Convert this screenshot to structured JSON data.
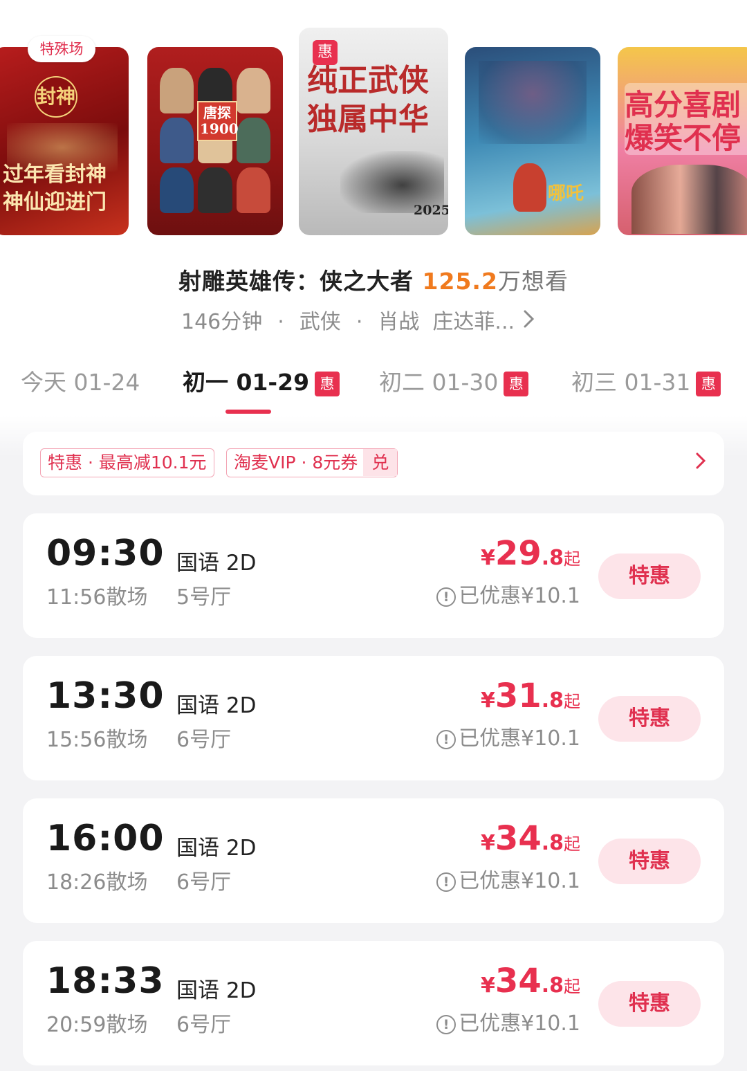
{
  "posters": {
    "special_tag": "特殊场",
    "hui_tag": "惠",
    "p1_line1": "过年看封神",
    "p1_line2": "神仙迎进门",
    "p1_logo": "封神",
    "p2_logo": "唐探1900",
    "p3_line1": "纯正武侠",
    "p3_line2": "独属中华",
    "p3_year": "2025",
    "p4_logo": "哪吒",
    "p5_line1": "高分喜剧",
    "p5_line2": "爆笑不停"
  },
  "movie": {
    "title": "射雕英雄传：侠之大者",
    "want_count": "125.2",
    "want_text": "万想看",
    "duration": "146分钟",
    "genre": "武侠",
    "cast": "肖战  庄达菲...",
    "separator": "·"
  },
  "dates": [
    {
      "label": "今天 01-24",
      "badge": ""
    },
    {
      "label": "初一 01-29",
      "badge": "惠"
    },
    {
      "label": "初二 01-30",
      "badge": "惠"
    },
    {
      "label": "初三 01-31",
      "badge": "惠"
    }
  ],
  "promo": {
    "chip1": "特惠 · 最高减10.1元",
    "chip2": "淘麦VIP · 8元券",
    "chip2_action": "兑",
    "arrow": "›"
  },
  "showtimes": [
    {
      "time": "09:30",
      "end": "11:56散场",
      "lang": "国语 2D",
      "hall": "5号厅",
      "yen": "¥",
      "price_int": "29",
      "price_dec": ".8",
      "suffix": "起",
      "discount": "已优惠¥10.1",
      "button": "特惠"
    },
    {
      "time": "13:30",
      "end": "15:56散场",
      "lang": "国语 2D",
      "hall": "6号厅",
      "yen": "¥",
      "price_int": "31",
      "price_dec": ".8",
      "suffix": "起",
      "discount": "已优惠¥10.1",
      "button": "特惠"
    },
    {
      "time": "16:00",
      "end": "18:26散场",
      "lang": "国语 2D",
      "hall": "6号厅",
      "yen": "¥",
      "price_int": "34",
      "price_dec": ".8",
      "suffix": "起",
      "discount": "已优惠¥10.1",
      "button": "特惠"
    },
    {
      "time": "18:33",
      "end": "20:59散场",
      "lang": "国语 2D",
      "hall": "6号厅",
      "yen": "¥",
      "price_int": "34",
      "price_dec": ".8",
      "suffix": "起",
      "discount": "已优惠¥10.1",
      "button": "特惠"
    }
  ],
  "colors": {
    "accent": "#e8304f",
    "want_orange": "#f07a1e",
    "button_bg": "#fde4e9"
  }
}
